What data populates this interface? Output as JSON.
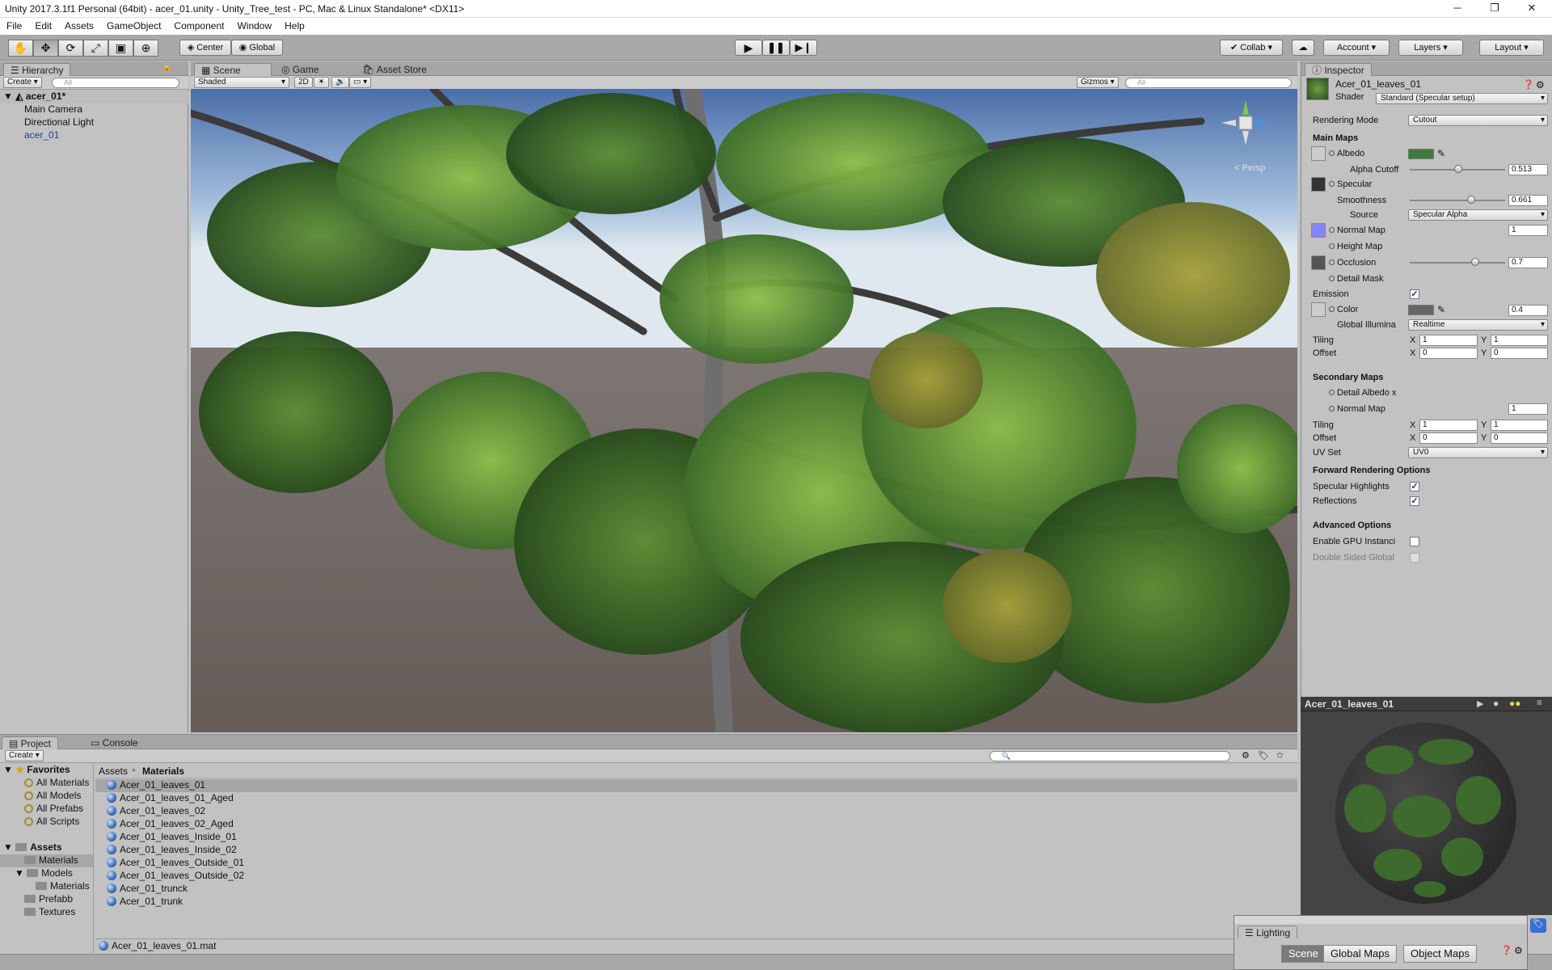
{
  "window": {
    "title": "Unity 2017.3.1f1 Personal (64bit) - acer_01.unity - Unity_Tree_test - PC, Mac & Linux Standalone* <DX11>",
    "minimize": "─",
    "maximize": "❐",
    "close": "✕"
  },
  "menu": [
    "File",
    "Edit",
    "Assets",
    "GameObject",
    "Component",
    "Window",
    "Help"
  ],
  "toolbar": {
    "tools": [
      "hand-tool-icon",
      "move-tool-icon",
      "rotate-tool-icon",
      "scale-tool-icon",
      "rect-tool-icon",
      "transform-tool-icon"
    ],
    "center": "Center",
    "global": "Global",
    "collab": "Collab",
    "account": "Account",
    "layers": "Layers",
    "layout": "Layout"
  },
  "hierarchy": {
    "tab": "Hierarchy",
    "create": "Create",
    "search_placeholder": "All",
    "scene": "acer_01*",
    "items": [
      "Main Camera",
      "Directional Light",
      "acer_01"
    ]
  },
  "scene_tabs": {
    "scene": "Scene",
    "game": "Game",
    "store": "Asset Store",
    "shaded": "Shaded",
    "mode2d": "2D",
    "gizmos": "Gizmos",
    "search_placeholder": "All",
    "persp": "Persp"
  },
  "inspector": {
    "tab": "Inspector",
    "material": "Acer_01_leaves_01",
    "shader_label": "Shader",
    "shader": "Standard (Specular setup)",
    "rendering_mode_label": "Rendering Mode",
    "rendering_mode": "Cutout",
    "main_maps": "Main Maps",
    "albedo": "Albedo",
    "albedo_color": "#3f7a3a",
    "alpha_cutoff_label": "Alpha Cutoff",
    "alpha_cutoff": "0.513",
    "alpha_cutoff_level": 0.513,
    "specular": "Specular",
    "smoothness_label": "Smoothness",
    "smoothness": "0.661",
    "smoothness_level": 0.661,
    "source_label": "Source",
    "source": "Specular Alpha",
    "normal_map": "Normal Map",
    "normal_value": "1",
    "height_map": "Height Map",
    "occlusion": "Occlusion",
    "occlusion_value": "0.7",
    "occlusion_level": 0.7,
    "detail_mask": "Detail Mask",
    "emission": "Emission",
    "color": "Color",
    "color_value": "0.4",
    "gi_label": "Global Illumina",
    "gi": "Realtime",
    "tiling": "Tiling",
    "offset": "Offset",
    "x": "X",
    "y": "Y",
    "one": "1",
    "zero": "0",
    "secondary_maps": "Secondary Maps",
    "detail_albedo": "Detail Albedo x",
    "normal_map2": "Normal Map",
    "normal_value2": "1",
    "uv_set_label": "UV Set",
    "uv_set": "UV0",
    "forward": "Forward Rendering Options",
    "spec_highlights": "Specular Highlights",
    "reflections": "Reflections",
    "advanced": "Advanced Options",
    "gpu_instancing": "Enable GPU Instanci",
    "double_sided": "Double Sided Global",
    "check": "✓"
  },
  "preview": {
    "title": "Acer_01_leaves_01"
  },
  "project": {
    "tab": "Project",
    "console": "Console",
    "create": "Create",
    "breadcrumb_root": "Assets",
    "breadcrumb_sep": "▸",
    "breadcrumb_leaf": "Materials",
    "favorites": "Favorites",
    "fav_items": [
      "All Materials",
      "All Models",
      "All Prefabs",
      "All Scripts"
    ],
    "assets": "Assets",
    "tree": [
      "Materials",
      "Models",
      "Materials",
      "Prefabb",
      "Textures"
    ],
    "files": [
      "Acer_01_leaves_01",
      "Acer_01_leaves_01_Aged",
      "Acer_01_leaves_02",
      "Acer_01_leaves_02_Aged",
      "Acer_01_leaves_Inside_01",
      "Acer_01_leaves_Inside_02",
      "Acer_01_leaves_Outside_01",
      "Acer_01_leaves_Outside_02",
      "Acer_01_trunck",
      "Acer_01_trunk"
    ],
    "selected_path": "Acer_01_leaves_01.mat"
  },
  "lighting": {
    "title": "Lighting",
    "tabs": [
      "Scene",
      "Global Maps",
      "Object Maps"
    ]
  }
}
